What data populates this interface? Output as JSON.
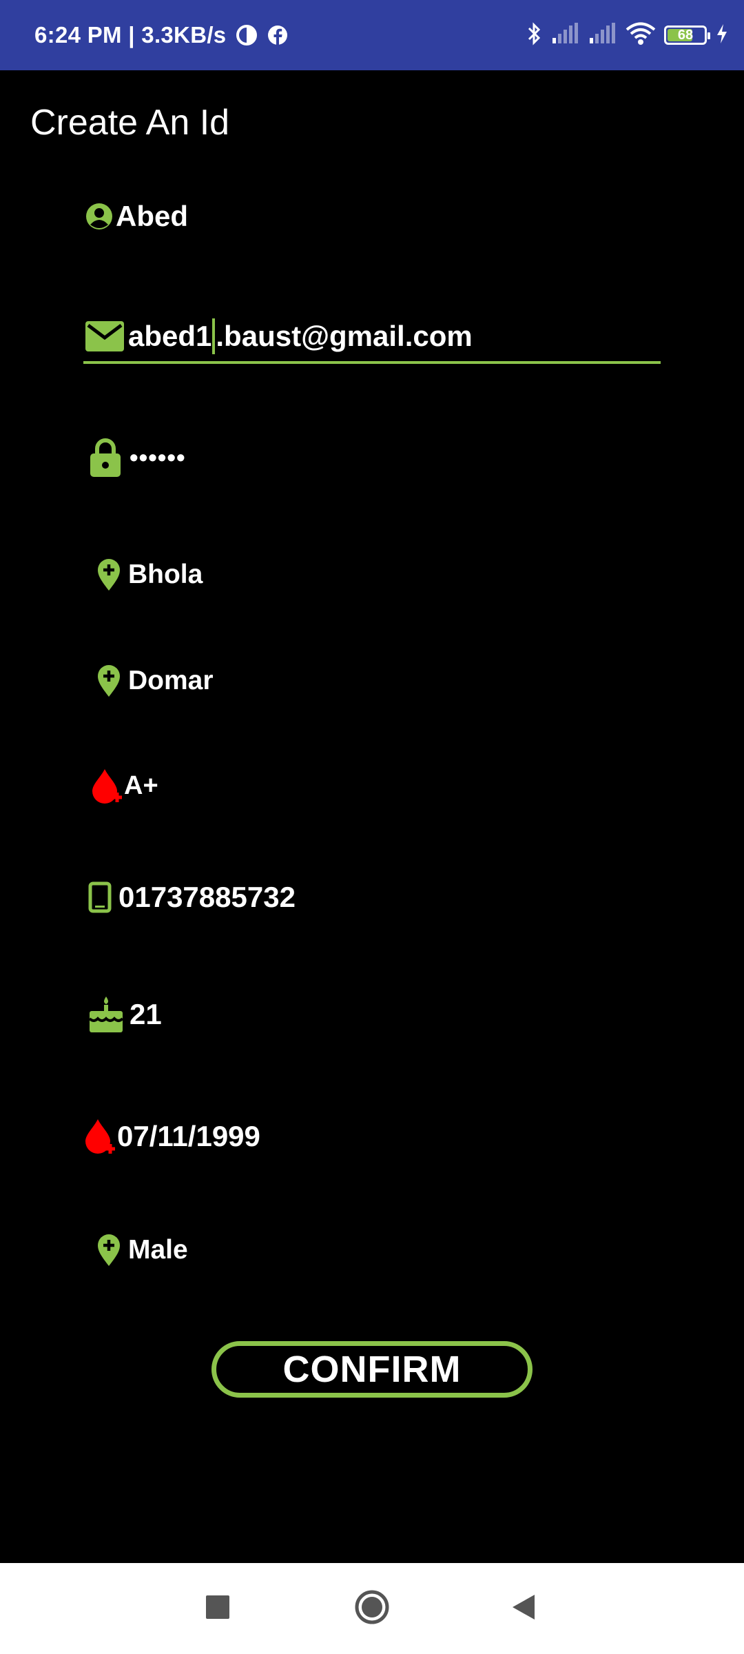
{
  "status_bar": {
    "time_speed": "6:24 PM | 3.3KB/s",
    "battery_level": "68"
  },
  "page": {
    "title": "Create An Id"
  },
  "form": {
    "name": "Abed",
    "email_before_cursor": "abed1",
    "email_after_cursor": ".baust@gmail.com",
    "password_masked": "••••••",
    "district": "Bhola",
    "upazila": "Domar",
    "blood_group": "A+",
    "phone": "01737885732",
    "age": "21",
    "last_donation_date": "07/11/1999",
    "gender": "Male"
  },
  "actions": {
    "confirm_label": "CONFIRM"
  },
  "colors": {
    "accent": "#8bc34a",
    "blood": "#ff0000",
    "status_bar": "#303f9f",
    "background": "#000000"
  },
  "icons": [
    "account-icon",
    "email-icon",
    "lock-icon",
    "location-icon",
    "blood-drop-icon",
    "phone-icon",
    "cake-icon",
    "nav-recents-icon",
    "nav-home-icon",
    "nav-back-icon"
  ]
}
